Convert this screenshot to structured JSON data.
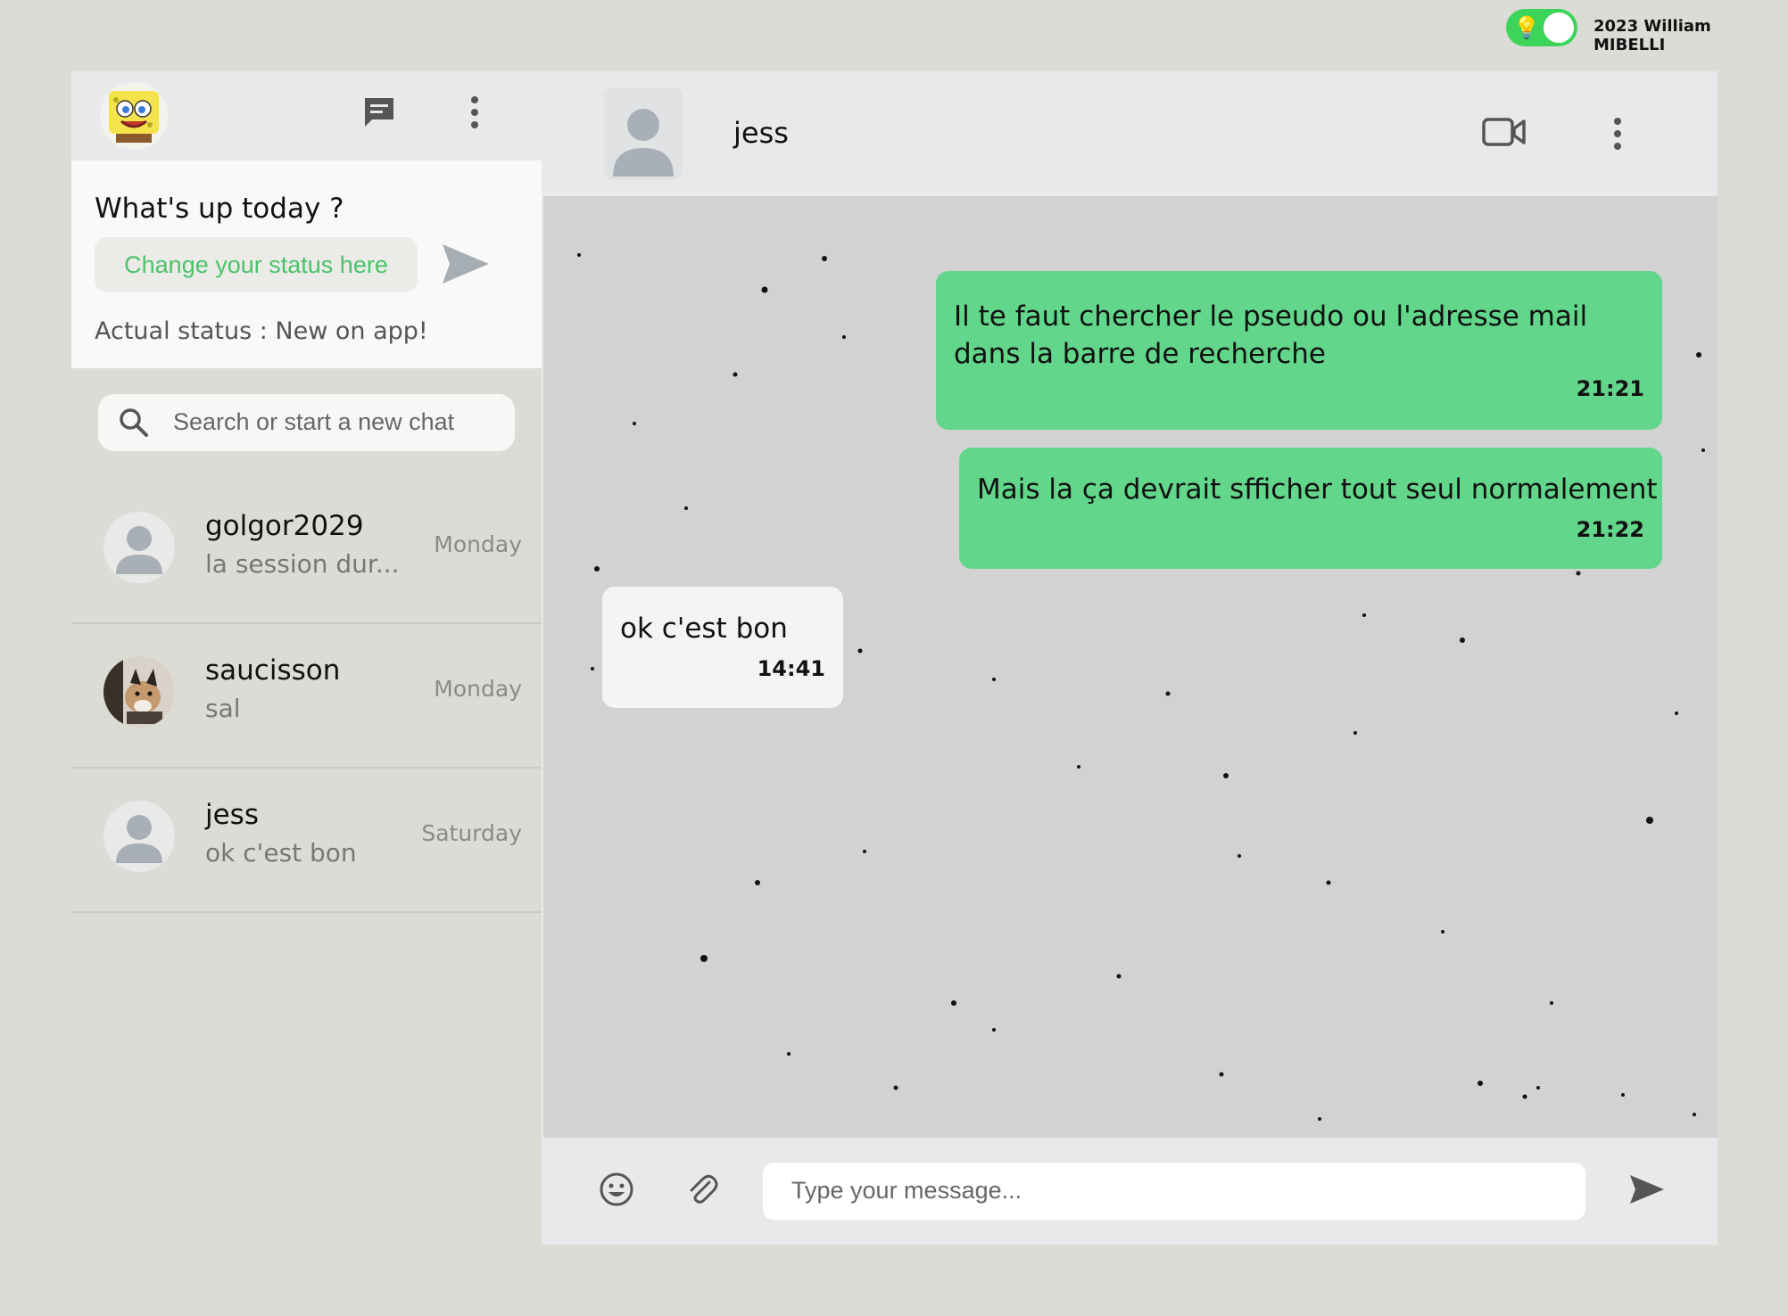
{
  "topbar": {
    "credit": "2023 William MIBELLI",
    "theme_toggle_icon": "lightbulb-icon",
    "toggle_color": "#3dd45a"
  },
  "sidebar": {
    "header_icons": [
      "new-chat-icon",
      "more-vertical-icon"
    ],
    "status_title": "What's up today ?",
    "status_placeholder": "Change your status here",
    "status_actual": "Actual status : New on app!",
    "search_placeholder": "Search or start a new chat",
    "chats": [
      {
        "name": "golgor2029",
        "preview": "la session dur...",
        "day": "Monday"
      },
      {
        "name": "saucisson",
        "preview": "sal",
        "day": "Monday"
      },
      {
        "name": "jess",
        "preview": "ok c'est bon",
        "day": "Saturday"
      }
    ]
  },
  "conversation": {
    "contact_name": "jess",
    "header_icons": [
      "video-call-icon",
      "more-vertical-icon"
    ],
    "messages": [
      {
        "direction": "out",
        "lines": [
          "Il te faut chercher le pseudo ou l'adresse mail",
          "dans la barre de recherche"
        ],
        "time": "21:21"
      },
      {
        "direction": "out",
        "lines": [
          "Mais la ça devrait sfficher tout seul normalement"
        ],
        "time": "21:22"
      },
      {
        "direction": "in",
        "lines": [
          "ok c'est bon"
        ],
        "time": "14:41"
      }
    ],
    "composer_placeholder": "Type your message...",
    "composer_icons": [
      "emoji-icon",
      "attach-icon",
      "send-icon"
    ]
  },
  "colors": {
    "accent_green": "#62d68a",
    "status_text_green": "#4cc36a",
    "background": "#dcdcd7"
  }
}
